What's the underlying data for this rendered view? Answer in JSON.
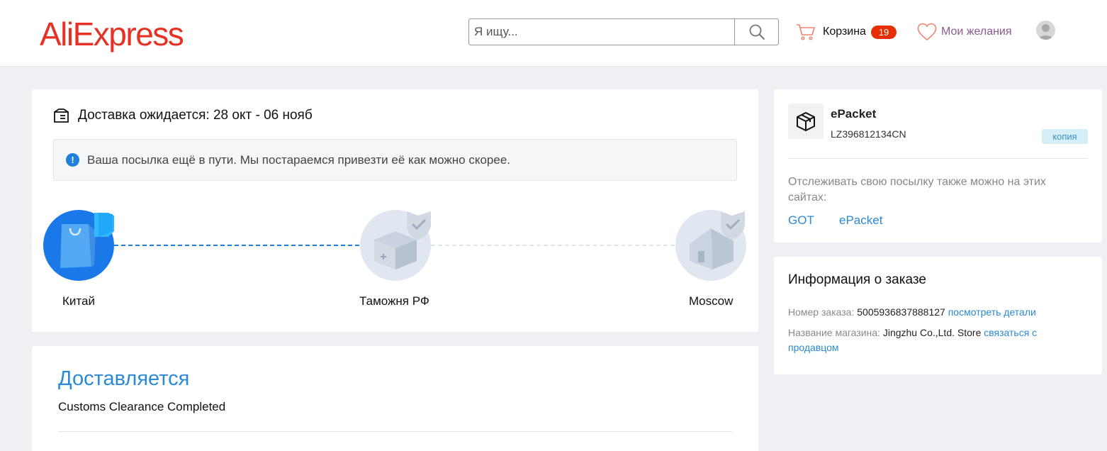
{
  "header": {
    "logo": "AliExpress",
    "search_placeholder": "Я ищу...",
    "cart_label": "Корзина",
    "cart_count": "19",
    "wishlist_label": "Мои желания"
  },
  "delivery": {
    "eta": "Доставка ожидается: 28 окт - 06 нояб",
    "notice": "Ваша посылка ещё в пути. Мы постараемся привезти её как можно скорее.",
    "stages": [
      {
        "label": "Китай",
        "status": "done"
      },
      {
        "label": "Таможня РФ",
        "status": "pending"
      },
      {
        "label": "Moscow",
        "status": "pending"
      }
    ]
  },
  "status": {
    "title": "Доставляется",
    "description": "Customs Clearance Completed"
  },
  "tracking": {
    "carrier": "ePacket",
    "number": "LZ396812134CN",
    "copy_label": "копия",
    "note": "Отслеживать свою посылку также можно на этих сайтах:",
    "links": [
      "GOT",
      "ePacket"
    ]
  },
  "order": {
    "title": "Информация о заказе",
    "number_label": "Номер заказа:",
    "number_value": "5005936837888127",
    "details_link": "посмотреть детали",
    "store_label": "Название магазина:",
    "store_value": "Jingzhu Co.,Ltd. Store",
    "contact_link": "связаться с продавцом"
  },
  "colors": {
    "brand": "#e43225",
    "accent": "#1f7fdb",
    "badge": "#e62e04"
  }
}
